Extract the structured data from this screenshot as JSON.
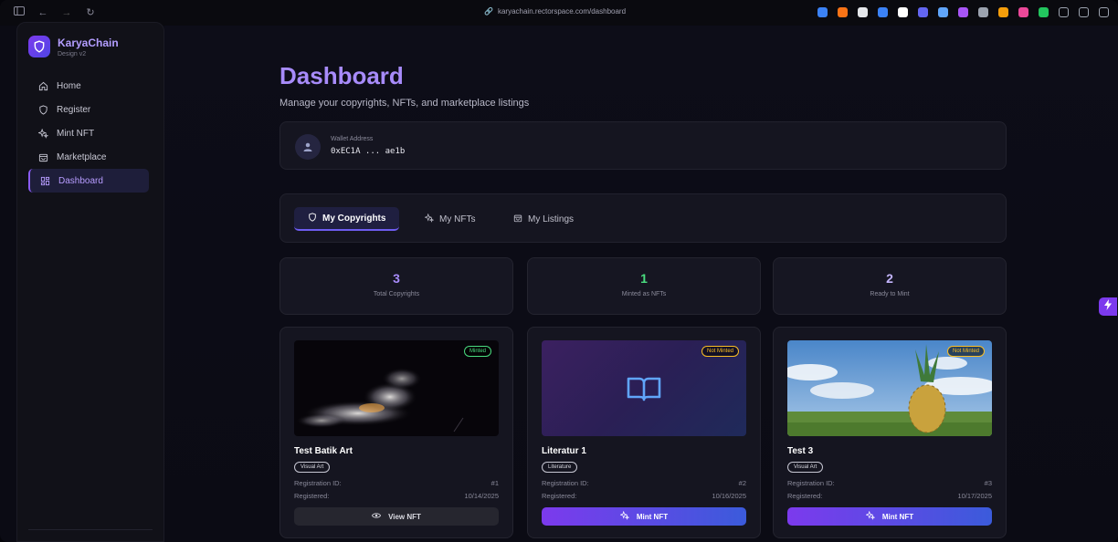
{
  "browser": {
    "url": "karyachain.rectorspace.com/dashboard",
    "extension_colors": [
      "#3b82f6",
      "#f97316",
      "#e5e7eb",
      "#3b82f6",
      "#ffffff",
      "#6366f1",
      "#60a5fa",
      "#a855f7",
      "#9ca3af",
      "#f59e0b",
      "#ec4899",
      "#22c55e",
      "#9ca3af",
      "#9ca3af",
      "#9ca3af"
    ]
  },
  "sidebar": {
    "brand_name": "KaryaChain",
    "brand_sub": "Design v2",
    "items": [
      {
        "label": "Home",
        "icon": "home-icon"
      },
      {
        "label": "Register",
        "icon": "shield-icon"
      },
      {
        "label": "Mint NFT",
        "icon": "sparkle-icon"
      },
      {
        "label": "Marketplace",
        "icon": "store-icon"
      },
      {
        "label": "Dashboard",
        "icon": "dashboard-icon",
        "active": true
      }
    ]
  },
  "header": {
    "title": "Dashboard",
    "subtitle": "Manage your copyrights, NFTs, and marketplace listings"
  },
  "wallet": {
    "label": "Wallet Address",
    "value": "0xEC1A ... ae1b"
  },
  "tabs": [
    {
      "label": "My Copyrights",
      "icon": "shield-icon",
      "active": true
    },
    {
      "label": "My NFTs",
      "icon": "sparkle-icon"
    },
    {
      "label": "My Listings",
      "icon": "store-icon"
    }
  ],
  "stats": [
    {
      "value": "3",
      "label": "Total Copyrights",
      "color": "#a78bfa"
    },
    {
      "value": "1",
      "label": "Minted as NFTs",
      "color": "#4ade80"
    },
    {
      "value": "2",
      "label": "Ready to Mint",
      "color": "#c4b5fd"
    }
  ],
  "cards": [
    {
      "title": "Test Batik Art",
      "status": "Minted",
      "status_color": "#4ade80",
      "category": "Visual Art",
      "reg_label": "Registration ID:",
      "reg_id": "#1",
      "date_label": "Registered:",
      "date": "10/14/2025",
      "button": "View NFT",
      "button_icon": "eye-icon",
      "button_style": "view"
    },
    {
      "title": "Literatur 1",
      "status": "Not Minted",
      "status_color": "#fbbf24",
      "category": "Literature",
      "reg_label": "Registration ID:",
      "reg_id": "#2",
      "date_label": "Registered:",
      "date": "10/16/2025",
      "button": "Mint NFT",
      "button_icon": "sparkle-icon",
      "button_style": "mint"
    },
    {
      "title": "Test 3",
      "status": "Not Minted",
      "status_color": "#fbbf24",
      "category": "Visual Art",
      "reg_label": "Registration ID:",
      "reg_id": "#3",
      "date_label": "Registered:",
      "date": "10/17/2025",
      "button": "Mint NFT",
      "button_icon": "sparkle-icon",
      "button_style": "mint"
    }
  ]
}
